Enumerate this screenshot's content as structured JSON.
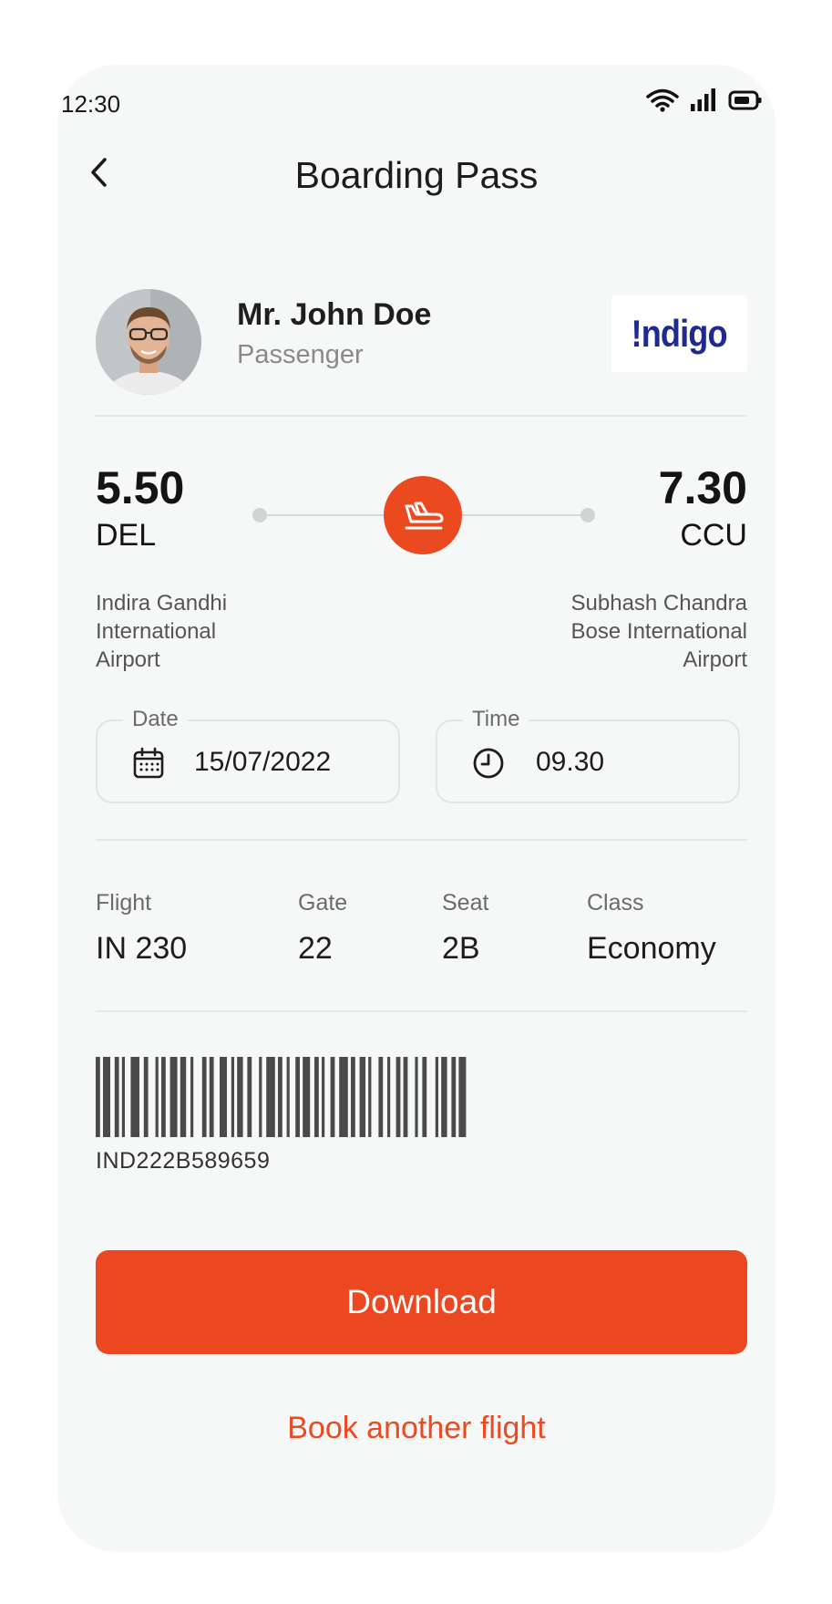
{
  "status_bar": {
    "time": "12:30",
    "icons": [
      "wifi-icon",
      "signal-icon",
      "battery-icon"
    ]
  },
  "header": {
    "title": "Boarding Pass",
    "back_icon": "chevron-left-icon"
  },
  "passenger": {
    "name": "Mr. John Doe",
    "role": "Passenger"
  },
  "airline": {
    "logo_text": "!ndigo"
  },
  "route": {
    "departure": {
      "time": "5.50",
      "code": "DEL",
      "airport_lines": [
        "Indira Gandhi",
        "International",
        "Airport"
      ]
    },
    "arrival": {
      "time": "7.30",
      "code": "CCU",
      "airport_lines": [
        "Subhash Chandra",
        "Bose International",
        "Airport"
      ]
    },
    "plane_icon": "plane-icon"
  },
  "date_field": {
    "label": "Date",
    "value": "15/07/2022",
    "icon": "calendar-icon"
  },
  "time_field": {
    "label": "Time",
    "value": "09.30",
    "icon": "clock-icon"
  },
  "details": [
    {
      "label": "Flight",
      "value": "IN 230"
    },
    {
      "label": "Gate",
      "value": "22"
    },
    {
      "label": "Seat",
      "value": "2B"
    },
    {
      "label": "Class",
      "value": "Economy"
    }
  ],
  "barcode": {
    "code": "IND222B589659"
  },
  "actions": {
    "download": "Download",
    "book_another": "Book another flight"
  },
  "colors": {
    "accent": "#eb4720",
    "background": "#f6f7f7",
    "airline_blue": "#1e2a90"
  }
}
